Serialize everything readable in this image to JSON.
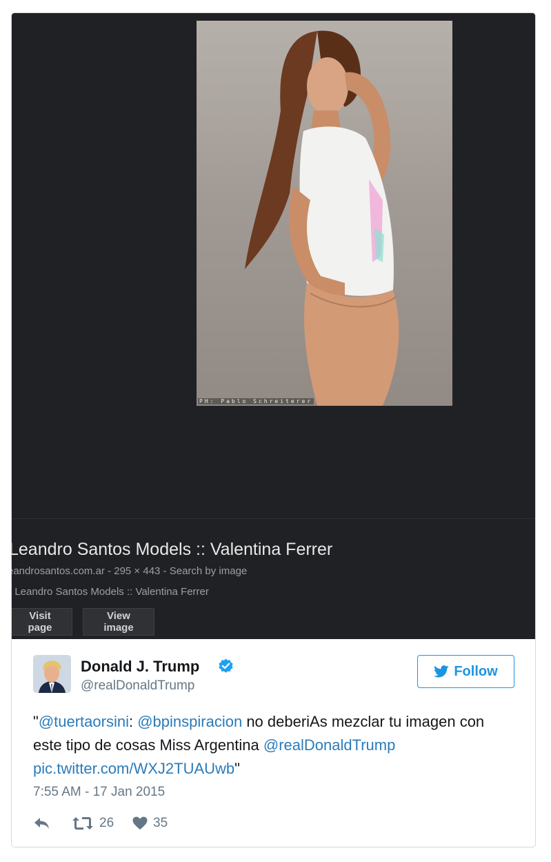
{
  "image_result": {
    "photo_credit": "PH: Pablo Schreiterer",
    "title": "Leandro Santos Models :: Valentina Ferrer",
    "meta": "eandrosantos.com.ar - 295 × 443 - Search by image",
    "description": ": Leandro Santos Models :: Valentina Ferrer",
    "visit_page_label": "Visit page",
    "view_image_label": "View image"
  },
  "tweet": {
    "display_name": "Donald J. Trump",
    "handle": "@realDonaldTrump",
    "follow_label": "Follow",
    "text": {
      "quote_open": "\"",
      "mention1": "@tuertaorsini",
      "colon": ": ",
      "mention2": "@bpinspiracion",
      "body": " no deberiAs mezclar tu imagen con este tipo de cosas Miss Argentina ",
      "mention3": "@realDonaldTrump",
      "space": " ",
      "link": "pic.twitter.com/WXJ2TUAUwb",
      "quote_close": "\""
    },
    "timestamp": "7:55 AM - 17 Jan 2015",
    "retweets": "26",
    "likes": "35"
  },
  "colors": {
    "twitter_blue": "#1b95e0",
    "link_blue": "#2b7bb9",
    "media_background": "#202124"
  },
  "icons": [
    "verified-badge-icon",
    "twitter-bird-icon",
    "reply-icon",
    "retweet-icon",
    "heart-icon"
  ]
}
